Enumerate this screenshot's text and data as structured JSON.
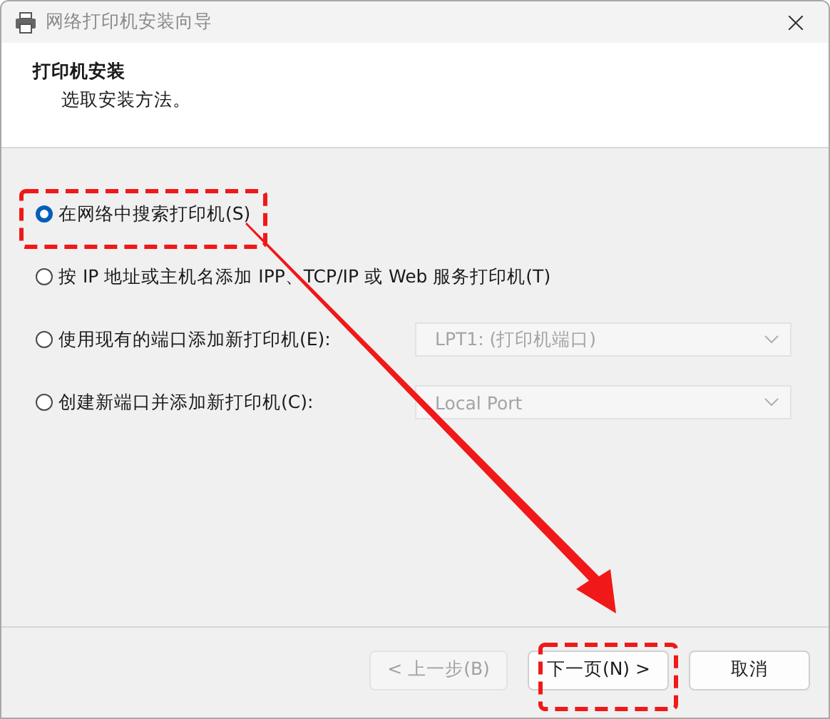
{
  "window": {
    "title": "网络打印机安装向导"
  },
  "header": {
    "title": "打印机安装",
    "subtitle": "选取安装方法。"
  },
  "options": [
    {
      "kind": "plain",
      "label": "在网络中搜索打印机(S)",
      "selected": true
    },
    {
      "kind": "plain",
      "label": "按 IP 地址或主机名添加 IPP、TCP/IP 或 Web 服务打印机(T)",
      "selected": false
    },
    {
      "kind": "dropdown",
      "label": "使用现有的端口添加新打印机(E):",
      "selected": false,
      "dropdown": {
        "value": "LPT1: (打印机端口)",
        "disabled": true
      }
    },
    {
      "kind": "dropdown",
      "label": "创建新端口并添加新打印机(C):",
      "selected": false,
      "dropdown": {
        "value": "Local Port",
        "disabled": true
      }
    }
  ],
  "buttons": [
    {
      "label": "< 上一步(B)",
      "disabled": true
    },
    {
      "label": "下一页(N) >",
      "disabled": false
    },
    {
      "label": "取消",
      "disabled": false
    }
  ]
}
